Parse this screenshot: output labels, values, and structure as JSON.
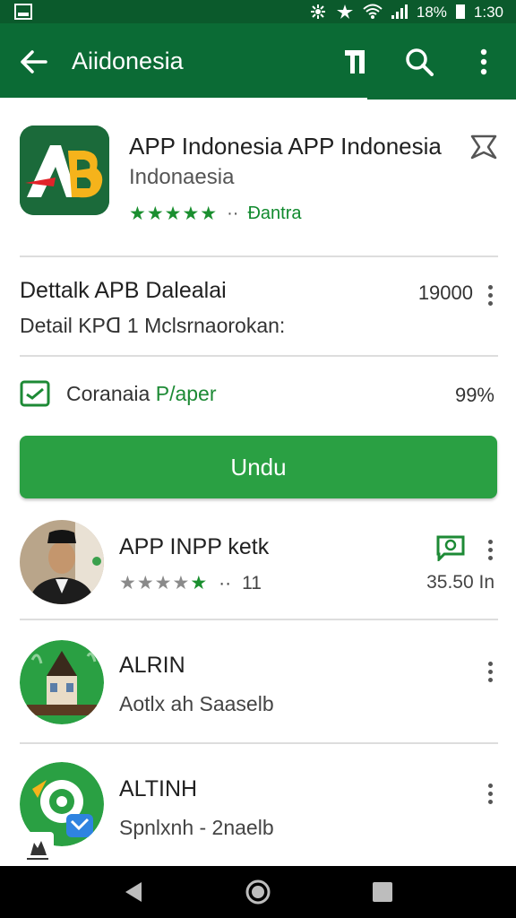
{
  "status_bar": {
    "battery": "18%",
    "time": "1:30"
  },
  "app_bar": {
    "title": "Aiidonesia"
  },
  "hero": {
    "name": "APP Indonesia APP Indonesia",
    "developer": "Indonaesia",
    "rating_stars": "★★★★★",
    "rating_dots": "··",
    "rating_label": "Ɖantra"
  },
  "detail": {
    "title": "Dettalk APB Dalealai",
    "subtitle": "Detail KPᗡ 1 Mclsrnaorokan:",
    "count": "19000"
  },
  "compat": {
    "label_prefix": "Coranaia ",
    "label_accent": "P/aper",
    "percent": "99%"
  },
  "install": {
    "label": "Undu"
  },
  "list": [
    {
      "title": "APP INPP ketk",
      "stars": "★★★★★",
      "dots": "··",
      "count": "11",
      "meta": "35.50 In"
    },
    {
      "title": "ALRIN",
      "subtitle": "Aotlx ah Saaselb"
    },
    {
      "title": "ALTINH",
      "subtitle": "Spnlxnh - 2naelb"
    }
  ],
  "colors": {
    "status_bar": "#0b5a2c",
    "app_bar": "#0b6b35",
    "accent_green": "#2aa043",
    "star_green": "#1a8f2f"
  },
  "icons": {
    "back": "arrow-left",
    "library": "library-icon",
    "search": "search-icon",
    "overflow": "more-vert-icon",
    "wishlist": "wishlist-icon",
    "compat": "checkbox-icon",
    "nav": [
      "back-triangle",
      "home-circle",
      "recents-square"
    ]
  }
}
